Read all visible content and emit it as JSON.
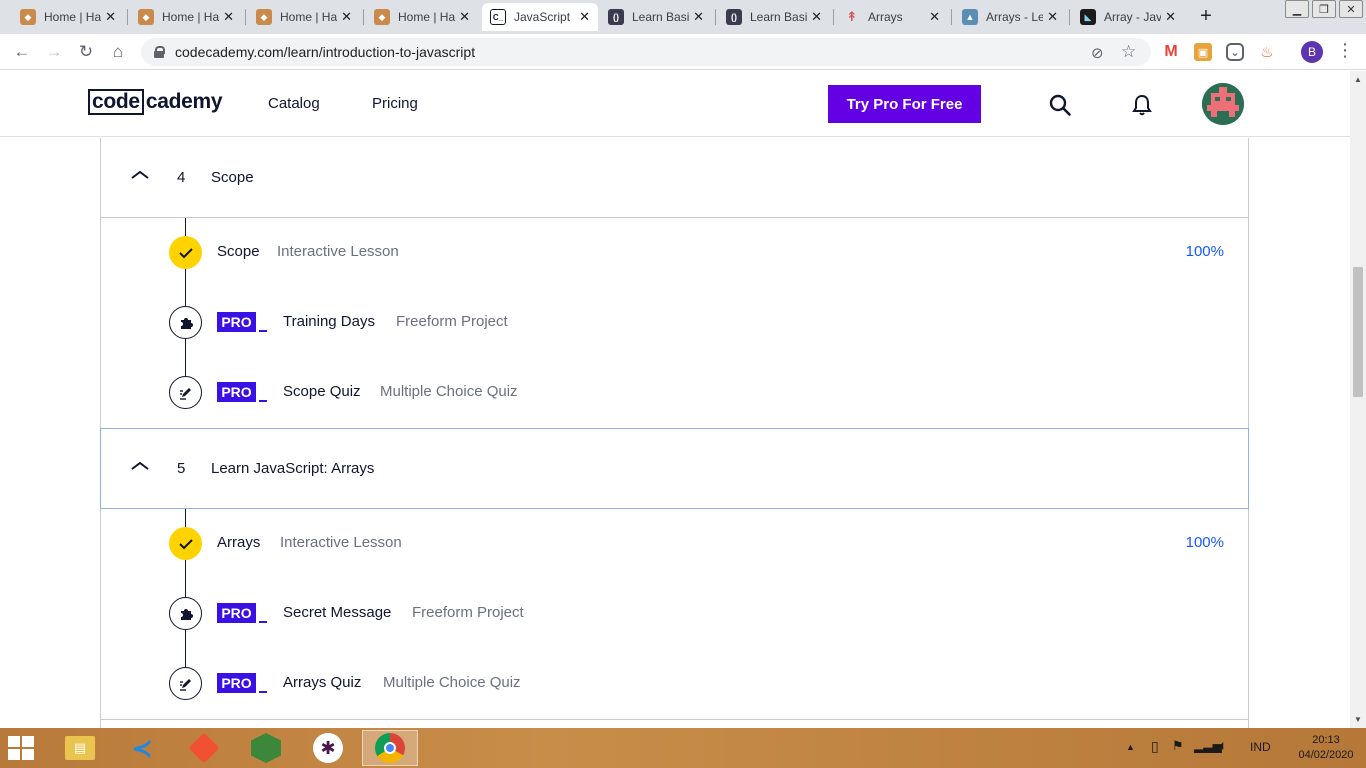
{
  "browser": {
    "tabs": [
      {
        "title": "Home | HackerRank",
        "favicon": "hackerrank-icon"
      },
      {
        "title": "Home | HackerRank",
        "favicon": "hackerrank-icon"
      },
      {
        "title": "Home | HackerRank",
        "favicon": "hackerrank-icon"
      },
      {
        "title": "Home | HackerRank",
        "favicon": "hackerrank-icon"
      },
      {
        "title": "JavaScript",
        "favicon": "codecademy-icon"
      },
      {
        "title": "Learn Basic",
        "favicon": "freecodecamp-icon"
      },
      {
        "title": "Learn Basic",
        "favicon": "freecodecamp-icon"
      },
      {
        "title": "Arrays",
        "favicon": "arrays-icon"
      },
      {
        "title": "Arrays - Le",
        "favicon": "sololearn-icon"
      },
      {
        "title": "Array - Jav",
        "favicon": "mdn-icon"
      }
    ],
    "active_tab_index": 4,
    "url": "codecademy.com/learn/introduction-to-javascript",
    "profile_initial": "B"
  },
  "site": {
    "nav": {
      "catalog": "Catalog",
      "pricing": "Pricing"
    },
    "cta_label": "Try Pro For Free",
    "brand_color": "#6400e4"
  },
  "modules": [
    {
      "number": "4",
      "title": "Scope",
      "lessons": [
        {
          "name": "Scope",
          "type": "Interactive Lesson",
          "pro": false,
          "completed": true,
          "progress": "100%",
          "icon": "check-icon"
        },
        {
          "name": "Training Days",
          "type": "Freeform Project",
          "pro": true,
          "completed": false,
          "icon": "puzzle-icon"
        },
        {
          "name": "Scope Quiz",
          "type": "Multiple Choice Quiz",
          "pro": true,
          "completed": false,
          "icon": "quiz-pencil-icon"
        }
      ]
    },
    {
      "number": "5",
      "title": "Learn JavaScript: Arrays",
      "lessons": [
        {
          "name": "Arrays",
          "type": "Interactive Lesson",
          "pro": false,
          "completed": true,
          "progress": "100%",
          "icon": "check-icon"
        },
        {
          "name": "Secret Message",
          "type": "Freeform Project",
          "pro": true,
          "completed": false,
          "icon": "puzzle-icon"
        },
        {
          "name": "Arrays Quiz",
          "type": "Multiple Choice Quiz",
          "pro": true,
          "completed": false,
          "icon": "quiz-pencil-icon"
        }
      ]
    }
  ],
  "pro_badge_label": "PRO",
  "taskbar": {
    "apps": [
      "file-explorer-icon",
      "vscode-icon",
      "git-icon",
      "nodejs-icon",
      "slack-icon",
      "chrome-icon"
    ],
    "language": "IND",
    "time": "20:13",
    "date": "04/02/2020"
  }
}
